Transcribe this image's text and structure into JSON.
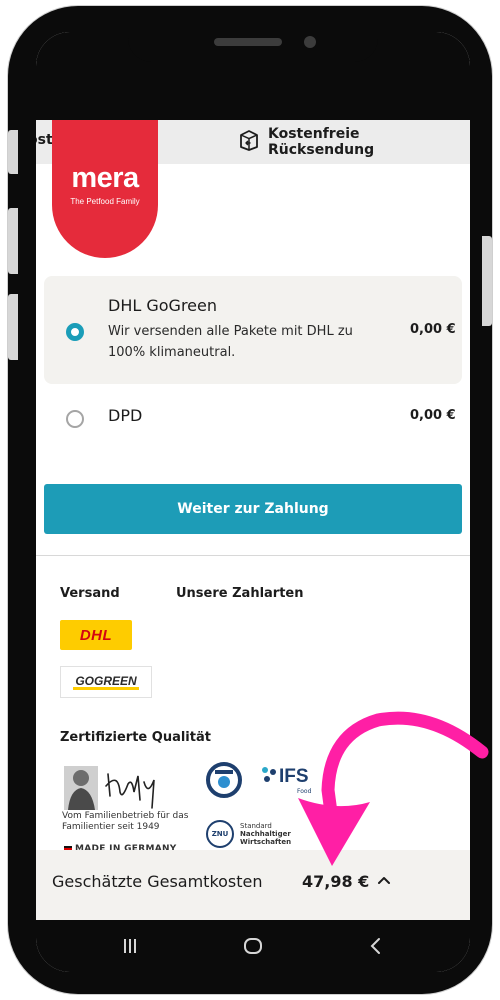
{
  "promo": {
    "left_text": "ost",
    "right_icon": "return-box-icon",
    "right_text": "Kostenfreie Rücksendung"
  },
  "brand": {
    "name": "mera",
    "tagline": "The Petfood Family",
    "color": "#e52b3b"
  },
  "shipping": {
    "options": [
      {
        "name": "DHL GoGreen",
        "description": "Wir versenden alle Pakete mit DHL zu 100% klimaneutral.",
        "price": "0,00 €",
        "selected": true
      },
      {
        "name": "DPD",
        "description": "",
        "price": "0,00 €",
        "selected": false
      }
    ]
  },
  "cta": {
    "label": "Weiter zur Zahlung",
    "color": "#1d9cb7"
  },
  "footer": {
    "versand_title": "Versand",
    "zahlarten_title": "Unsere Zahlarten",
    "dhl_logo_text": "DHL",
    "gogreen_logo_text": "GOGREEN",
    "quality_title": "Zertifizierte Qualität",
    "founder_text": "Vom Familienbetrieb für das Familientier seit 1949",
    "made_in": "MADE IN GERMANY",
    "ifs_text": "IFS",
    "ifs_sub": "Food",
    "znu_badge": "ZNU",
    "znu_line1": "Standard",
    "znu_line2": "Nachhaltiger",
    "znu_line3": "Wirtschaften"
  },
  "summary": {
    "label": "Geschätzte Gesamtkosten",
    "total": "47,98 €",
    "toggle_icon": "chevron-up-icon"
  },
  "annotation": {
    "arrow_color": "#ff1fa5"
  }
}
